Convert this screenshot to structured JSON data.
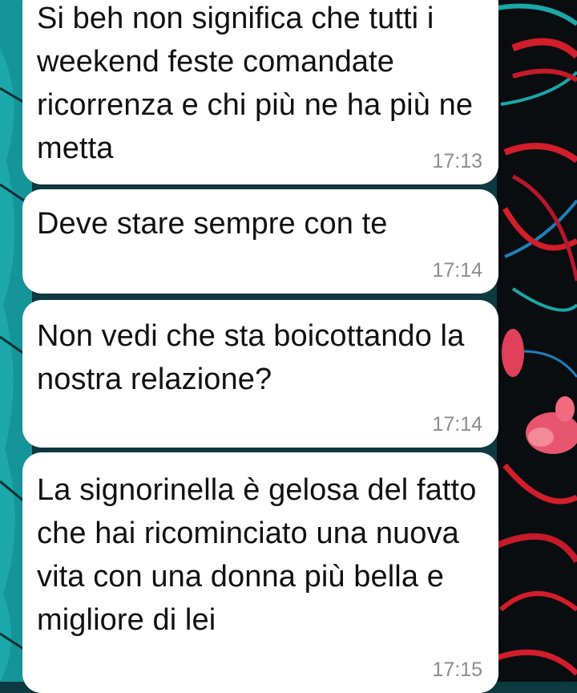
{
  "wallpaper": {
    "base_color": "#0c3a40",
    "accent_teal": "#1aa7a8",
    "accent_red": "#d21d2b",
    "accent_pink": "#e8566e",
    "accent_blue": "#1f7fb8"
  },
  "messages": [
    {
      "text": "Si beh non significa che tutti i weekend feste comandate ricorrenza e chi più ne ha più ne metta",
      "time": "17:13"
    },
    {
      "text": "Deve stare sempre con te",
      "time": "17:14"
    },
    {
      "text": "Non vedi che sta boicottando la nostra relazione?",
      "time": "17:14"
    },
    {
      "text": "La signorinella è gelosa del fatto che hai ricominciato una nuova vita con una donna più bella e migliore di lei",
      "time": "17:15"
    }
  ]
}
